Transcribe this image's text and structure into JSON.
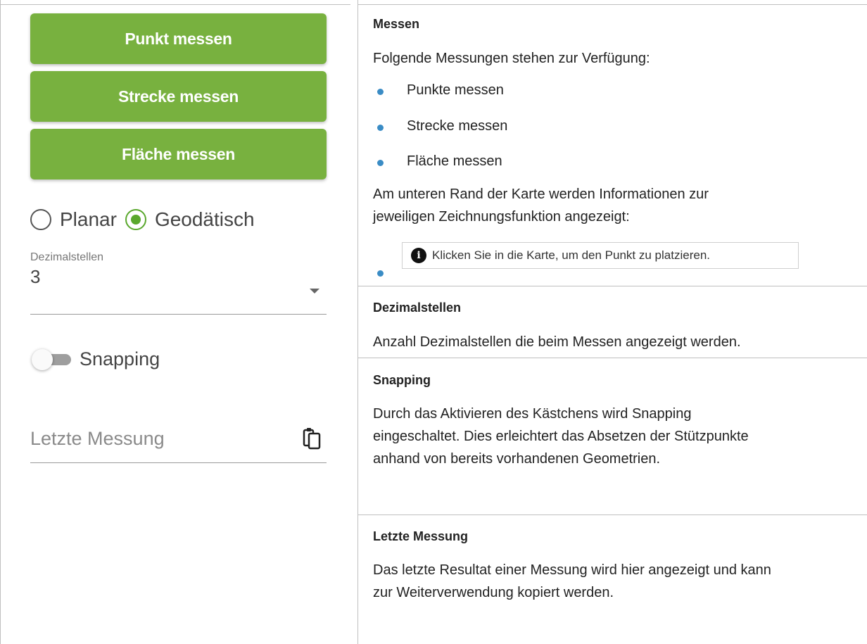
{
  "left": {
    "buttons": {
      "point": "Punkt messen",
      "line": "Strecke messen",
      "area": "Fläche messen"
    },
    "radio": {
      "planar": "Planar",
      "geodetic": "Geodätisch",
      "selected": "geodetic"
    },
    "decimals": {
      "label": "Dezimalstellen",
      "value": "3"
    },
    "snapping": {
      "label": "Snapping",
      "on": false
    },
    "last": {
      "placeholder": "Letzte Messung"
    }
  },
  "right": {
    "messen": {
      "title": "Messen",
      "intro": "Folgende Messungen stehen zur Verfügung:",
      "items": [
        "Punkte messen",
        "Strecke messen",
        "Fläche messen"
      ],
      "info_text_line1": "Am unteren Rand der Karte werden Informationen zur",
      "info_text_line2": "jeweiligen Zeichnungsfunktion angezeigt:",
      "info_box": "Klicken Sie in die Karte, um den Punkt zu platzieren."
    },
    "dezimal": {
      "title": "Dezimalstellen",
      "text": "Anzahl Dezimalstellen die beim Messen angezeigt werden."
    },
    "snapping": {
      "title": "Snapping",
      "line1": "Durch das Aktivieren des Kästchens wird Snapping",
      "line2": "eingeschaltet. Dies erleichtert das Absetzen der Stützpunkte",
      "line3": "anhand von bereits vorhandenen Geometrien."
    },
    "letzte": {
      "title": "Letzte Messung",
      "line1": "Das letzte Resultat einer Messung wird hier angezeigt und kann",
      "line2": "zur Weiterverwendung kopiert werden."
    }
  },
  "colors": {
    "button": "#78b13f",
    "radio_active": "#5aa82d",
    "bullet": "#3a8cc5"
  }
}
